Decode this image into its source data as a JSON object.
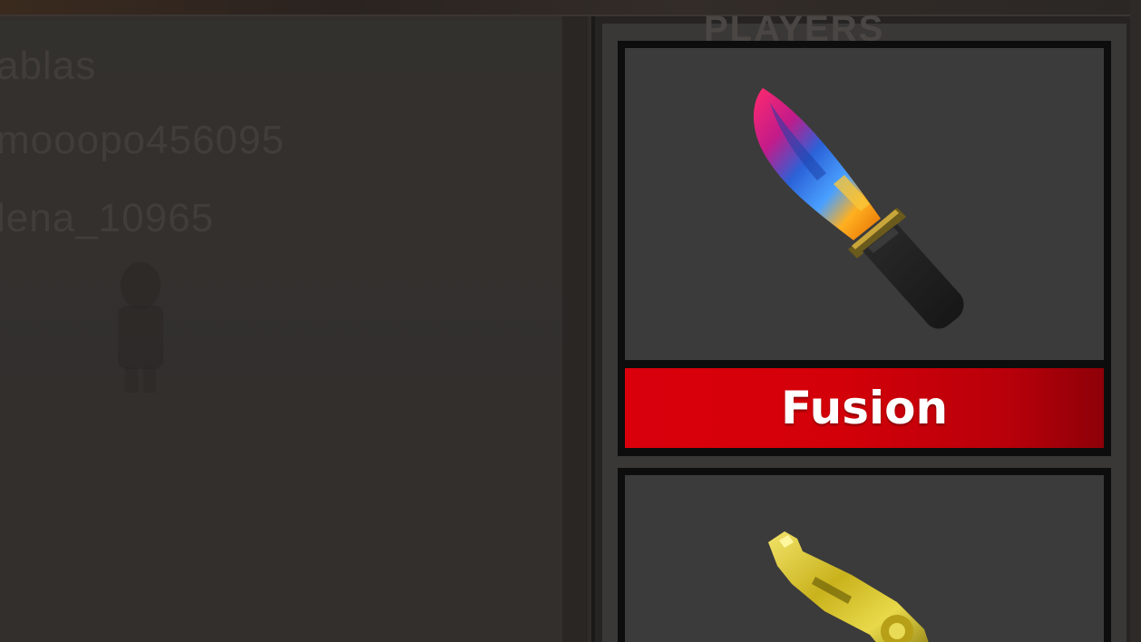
{
  "panel_title": "PLAYERS",
  "players": [
    "ablas",
    "mooopo456095",
    "lena_10965"
  ],
  "inventory": [
    {
      "name": "Fusion",
      "icon": "rainbow-knife-icon",
      "rarity_color": "#d9000c"
    },
    {
      "name": "",
      "icon": "gold-gun-icon",
      "rarity_color": ""
    }
  ]
}
